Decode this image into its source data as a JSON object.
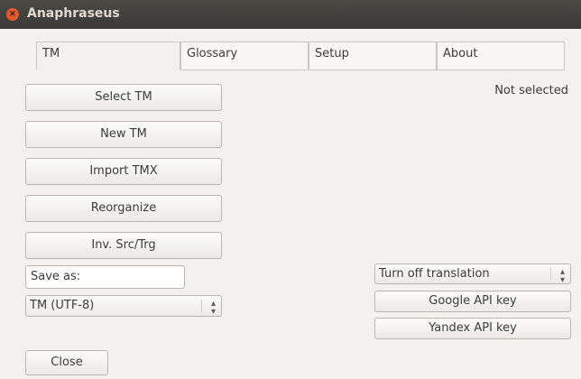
{
  "window": {
    "title": "Anaphraseus",
    "close_glyph": "×"
  },
  "tabs": [
    {
      "label": "TM",
      "active": true
    },
    {
      "label": "Glossary",
      "active": false
    },
    {
      "label": "Setup",
      "active": false
    },
    {
      "label": "About",
      "active": false
    }
  ],
  "tm_panel": {
    "select_tm": "Select TM",
    "new_tm": "New TM",
    "import_tmx": "Import TMX",
    "reorganize": "Reorganize",
    "inv_src_trg": "Inv. Src/Trg",
    "save_as_value": "Save as:",
    "encoding_selected": "TM (UTF-8)",
    "close": "Close",
    "status": "Not selected",
    "translation_selected": "Turn off translation",
    "google_api_key": "Google API key",
    "yandex_api_key": "Yandex API key"
  },
  "colors": {
    "close_dot": "#e05a30",
    "titlebar": "#3b3a36",
    "window_bg": "#f2f1f0"
  }
}
